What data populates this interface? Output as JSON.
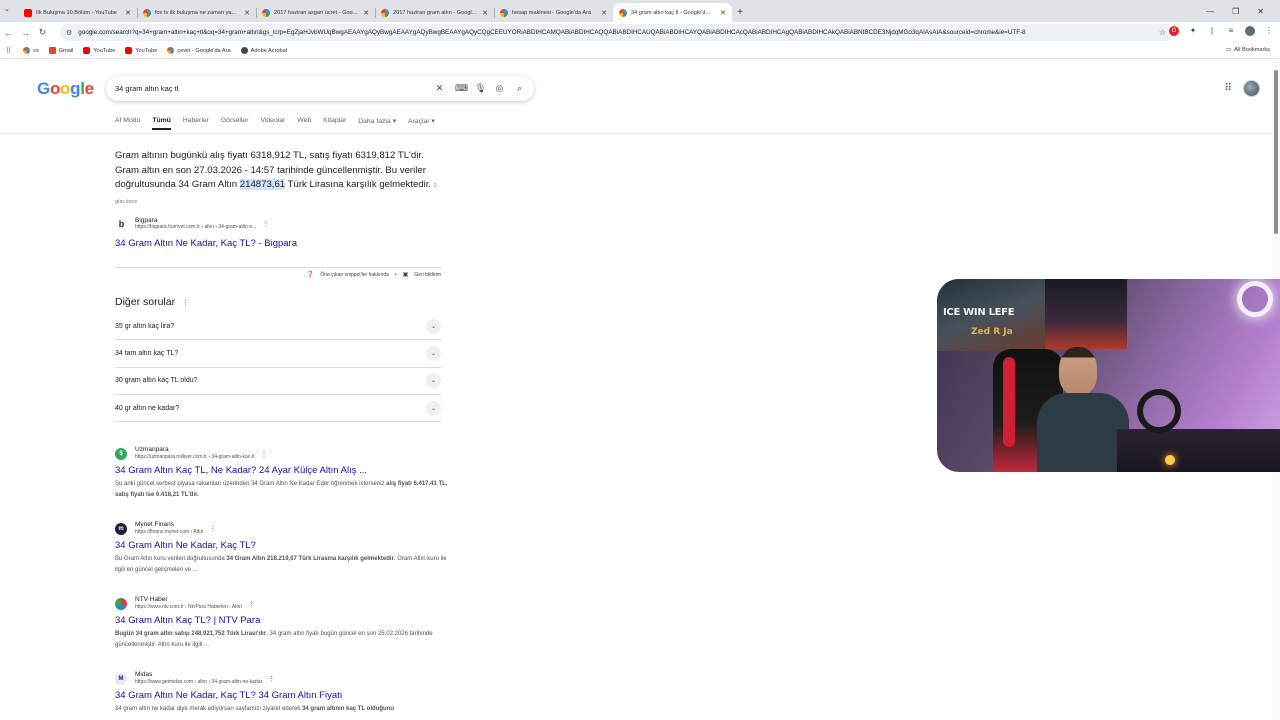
{
  "browser": {
    "tabs": [
      {
        "label": "İlk Buluşma 10.Bölüm - YouTube",
        "favicon": "youtube-icon",
        "active": false
      },
      {
        "label": "fox tv ilk buluşma ne zaman ya...",
        "favicon": "google-icon",
        "active": false
      },
      {
        "label": "2017 haziran asgari ücret - Goo...",
        "favicon": "google-icon",
        "active": false
      },
      {
        "label": "2017 haziran gram altın - Googl...",
        "favicon": "google-icon",
        "active": false
      },
      {
        "label": "hesap makinesi - Google'da Ara",
        "favicon": "google-icon",
        "active": false
      },
      {
        "label": "34 gram altın kaç tl - Google'd...",
        "favicon": "google-icon",
        "active": true
      }
    ],
    "url": "google.com/search?q=34+gram+altın+kaç+tl&oq=34+gram+altın&gs_lcrp=EgZjaHJvbWUqBwgAEAAYgAQyBwgAEAAYgAQyBwgBEAAYgAQyCQgCEEUYORiABDIHCAMQABiABDIHCAQQABiABDIHCAUQABiABDIHCAYQABiABDIHCAcQABiABDIHCAgQABiABDIHCAkQABiABNIBCDE3NjdqMGo3qAIAsAIA&sourceid=chrome&ie=UTF-8",
    "bookmarks": [
      {
        "label": "cs",
        "icon": "google-icon"
      },
      {
        "label": "Gmail",
        "icon": "gmail-icon"
      },
      {
        "label": "YouTube",
        "icon": "youtube-icon"
      },
      {
        "label": "YouTube",
        "icon": "youtube-icon"
      },
      {
        "label": "çeviri - Google'da Ara",
        "icon": "google-icon"
      },
      {
        "label": "Adobe Acrobat",
        "icon": "acrobat-icon"
      }
    ],
    "all_bookmarks": "All Bookmarks"
  },
  "search": {
    "logo": [
      "G",
      "o",
      "o",
      "g",
      "l",
      "e"
    ],
    "query": "34 gram altın kaç tl",
    "tabs": [
      "AI Modu",
      "Tümü",
      "Haberler",
      "Görseller",
      "Videolar",
      "Web",
      "Kitaplar",
      "Daha fazla ▾",
      "Araçlar ▾"
    ],
    "active_tab": "Tümü"
  },
  "snippet": {
    "text_before": "Gram altının bugünkü alış fiyatı 6318,912 TL, satış fiyatı 6319,812 TL'dir. Gram altın en son 27.03.2026 - 14:57 tarihinde güncellenmiştir. Bu veriler doğrultusunda 34 Gram Altın ",
    "highlight": "214873,61",
    "text_after": " Türk Lirasına karşılık gelmektedir.",
    "date": "2 gün önce",
    "source_name": "Bigpara",
    "source_url": "https://bigpara.hurriyet.com.tr › altın › 34-gram-altin-n...",
    "title": "34 Gram Altın Ne Kadar, Kaç TL? - Bigpara",
    "footer_about": "Öne çıkan snippet'ler hakkında",
    "footer_sep": "•",
    "footer_feedback": "Geri bildirim"
  },
  "paa": {
    "title": "Diğer sorular",
    "questions": [
      "35 gr altın kaç lira?",
      "34 tam altın kaç TL?",
      "30 gram altın kaç TL oldu?",
      "40 gr altın ne kadar?"
    ]
  },
  "results": [
    {
      "name": "Uzmanpara",
      "url": "https://uzmanpara.milliyet.com.tr › 34-gram-altin-kac-tl",
      "title": "34 Gram Altın Kaç TL, Ne Kadar? 24 Ayar Külçe Altın Alış ...",
      "desc_a": "Şu anki güncel serbest piyasa rakamları üzerinden 34 Gram Altın Ne Kadar Eder öğrenmek isterseniz ",
      "desc_b": "alış fiyatı 6.417,41 TL, satış fiyatı ise 6.418,21 TL'dir.",
      "desc_c": ""
    },
    {
      "name": "Mynet Finans",
      "url": "https://finans.mynet.com › Altın",
      "title": "34 Gram Altın Ne Kadar, Kaç TL?",
      "desc_a": "Bu Gram Altın kuru verileri doğrultusunda ",
      "desc_b": "34 Gram Altın 218.219,07 Türk Lirasına karşılık gelmektedir",
      "desc_c": ". Gram Altın kuru ile ilgili en güncel gelişmeleri ve ..."
    },
    {
      "name": "NTV Haber",
      "url": "https://www.ntv.com.tr › NtvPara Haberleri › Altın",
      "title": "34 Gram Altın Kaç TL? | NTV Para",
      "desc_a": "",
      "desc_b": "Bugün 34 gram altın satışı 248.921,752 Türk Lirası'dır",
      "desc_c": ". 34 gram altın fiyatı bugün güncel en son 25.02.2026 tarihinde güncellenmiştir. Altın kuru ile ilgili ..."
    },
    {
      "name": "Midas",
      "url": "https://www.getmidas.com › altın › 34-gram-altin-ne-kadar",
      "title": "34 Gram Altın Ne Kadar, Kaç TL? 34 Gram Altın Fiyatı",
      "desc_a": "34 gram altın ne kadar diye merak ediyorsan sayfamızı ziyaret ederek ",
      "desc_b": "34 gram altının kaç TL olduğunu",
      "desc_c": ""
    }
  ],
  "webcam": {
    "poster_line1": "ICE WIN LEFE",
    "poster_line2": "Zed R Ja"
  },
  "colors": {
    "link": "#1a0dab",
    "highlight": "#d3e3fd",
    "tabstrip": "#dfe3e8"
  }
}
